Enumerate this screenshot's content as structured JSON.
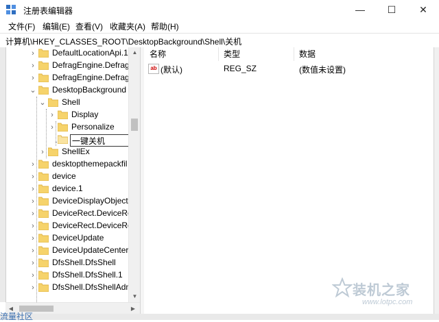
{
  "window": {
    "title": "注册表编辑器",
    "controls": [
      "—",
      "☐",
      "✕"
    ]
  },
  "menu": [
    "文件(F)",
    "编辑(E)",
    "查看(V)",
    "收藏夹(A)",
    "帮助(H)"
  ],
  "address": "计算机\\HKEY_CLASSES_ROOT\\DesktopBackground\\Shell\\关机",
  "tree": {
    "items": [
      {
        "label": "DefaultLocationApi.1",
        "twisty": "›"
      },
      {
        "label": "DefragEngine.Defrag",
        "twisty": "›"
      },
      {
        "label": "DefragEngine.Defrag",
        "twisty": "›"
      },
      {
        "label": "DesktopBackground",
        "twisty": "⌄"
      },
      {
        "label": "Shell",
        "twisty": "⌄"
      },
      {
        "label": "Display",
        "twisty": "›"
      },
      {
        "label": "Personalize",
        "twisty": "›"
      },
      {
        "label": "一键关机",
        "twisty": ""
      },
      {
        "label": "ShellEx",
        "twisty": "›"
      },
      {
        "label": "desktopthemepackfil",
        "twisty": "›"
      },
      {
        "label": "device",
        "twisty": "›"
      },
      {
        "label": "device.1",
        "twisty": "›"
      },
      {
        "label": "DeviceDisplayObject",
        "twisty": "›"
      },
      {
        "label": "DeviceRect.DeviceRec",
        "twisty": "›"
      },
      {
        "label": "DeviceRect.DeviceRec",
        "twisty": "›"
      },
      {
        "label": "DeviceUpdate",
        "twisty": "›"
      },
      {
        "label": "DeviceUpdateCenter",
        "twisty": "›"
      },
      {
        "label": "DfsShell.DfsShell",
        "twisty": "›"
      },
      {
        "label": "DfsShell.DfsShell.1",
        "twisty": "›"
      },
      {
        "label": "DfsShell.DfsShellAdm",
        "twisty": "›"
      }
    ],
    "editing_value": "一键关机"
  },
  "list": {
    "headers": {
      "name": "名称",
      "type": "类型",
      "data": "数据"
    },
    "rows": [
      {
        "icon": "ab",
        "name": "(默认)",
        "type": "REG_SZ",
        "data": "(数值未设置)"
      }
    ]
  },
  "watermark": {
    "text": "装机之家",
    "url": "www.lotpc.com"
  },
  "corner_text": "流量社区",
  "colors": {
    "folder": "#f6d36b",
    "folder_dark": "#e0b445",
    "accent": "#3a6fb0"
  }
}
